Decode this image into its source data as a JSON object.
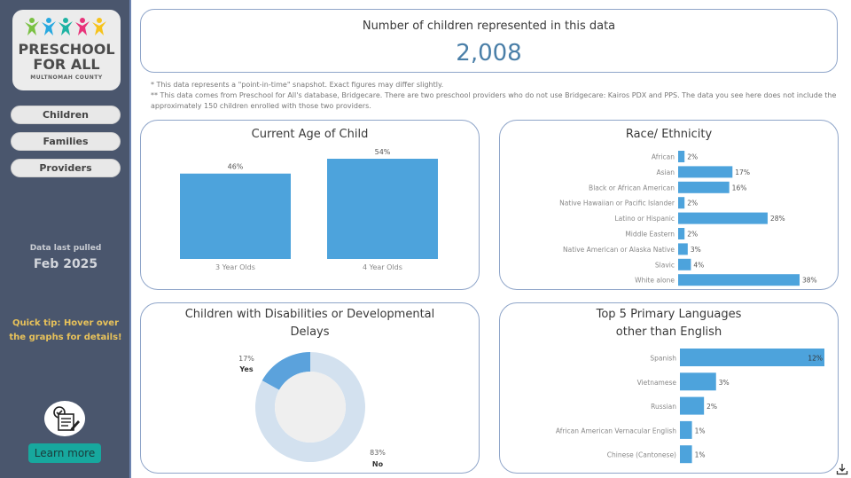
{
  "sidebar": {
    "logo": {
      "line1": "PRESCHOOL",
      "line2": "FOR ALL",
      "line3": "MULTNOMAH COUNTY",
      "kid_colors": [
        "#7ac143",
        "#29a9e0",
        "#1fb3a3",
        "#e8337a",
        "#f6c31c"
      ]
    },
    "nav": [
      {
        "label": "Children"
      },
      {
        "label": "Families"
      },
      {
        "label": "Providers"
      }
    ],
    "data_pulled_label": "Data last pulled",
    "data_pulled_date": "Feb 2025",
    "quick_tip": "Quick tip: Hover over the graphs for details!",
    "learn_more": "Learn more"
  },
  "summary": {
    "title": "Number of children represented in this data",
    "value": "2,008"
  },
  "notes": {
    "note1": "* This data represents a \"point-in-time\" snapshot. Exact figures may differ slightly.",
    "note2": "** This data comes from Preschool for All's database, Bridgecare. There are two preschool providers who do not use Bridgecare: Kairos PDX and PPS. The data you see here does not include the approximately 150 children enrolled with those two providers."
  },
  "colors": {
    "bar": "#4da3dc",
    "donut_yes": "#5ba2dc",
    "donut_no": "#d3e1ef",
    "donut_hole": "#efefef",
    "accent_number": "#4a7fa8"
  },
  "chart_data": [
    {
      "id": "age",
      "type": "bar",
      "title": "Current Age of Child",
      "categories": [
        "3 Year Olds",
        "4 Year Olds"
      ],
      "values": [
        46,
        54
      ],
      "labels": [
        "46%",
        "54%"
      ],
      "ylim": [
        0,
        54
      ]
    },
    {
      "id": "race",
      "type": "bar",
      "orientation": "horizontal",
      "title": "Race/ Ethnicity",
      "categories": [
        "African",
        "Asian",
        "Black or African American",
        "Native Hawaiian or Pacific Islander",
        "Latino or Hispanic",
        "Middle Eastern",
        "Native American or Alaska Native",
        "Slavic",
        "White alone"
      ],
      "values": [
        2,
        17,
        16,
        2,
        28,
        2,
        3,
        4,
        38
      ],
      "labels": [
        "2%",
        "17%",
        "16%",
        "2%",
        "28%",
        "2%",
        "3%",
        "4%",
        "38%"
      ],
      "xlim": [
        0,
        38
      ]
    },
    {
      "id": "disabilities",
      "type": "pie",
      "donut": true,
      "title": "Children with Disabilities or Developmental Delays",
      "title_line1": "Children with Disabilities or Developmental",
      "title_line2": "Delays",
      "categories": [
        "Yes",
        "No"
      ],
      "values": [
        17,
        83
      ],
      "labels": [
        "17%",
        "83%"
      ]
    },
    {
      "id": "languages",
      "type": "bar",
      "orientation": "horizontal",
      "title": "Top 5 Primary Languages other than English",
      "title_line1": "Top 5 Primary Languages",
      "title_line2": "other than English",
      "categories": [
        "Spanish",
        "Vietnamese",
        "Russian",
        "African American Vernacular English",
        "Chinese (Cantonese)"
      ],
      "values": [
        12,
        3,
        2,
        1,
        1
      ],
      "labels": [
        "12%",
        "3%",
        "2%",
        "1%",
        "1%"
      ],
      "xlim": [
        0,
        12
      ]
    }
  ]
}
